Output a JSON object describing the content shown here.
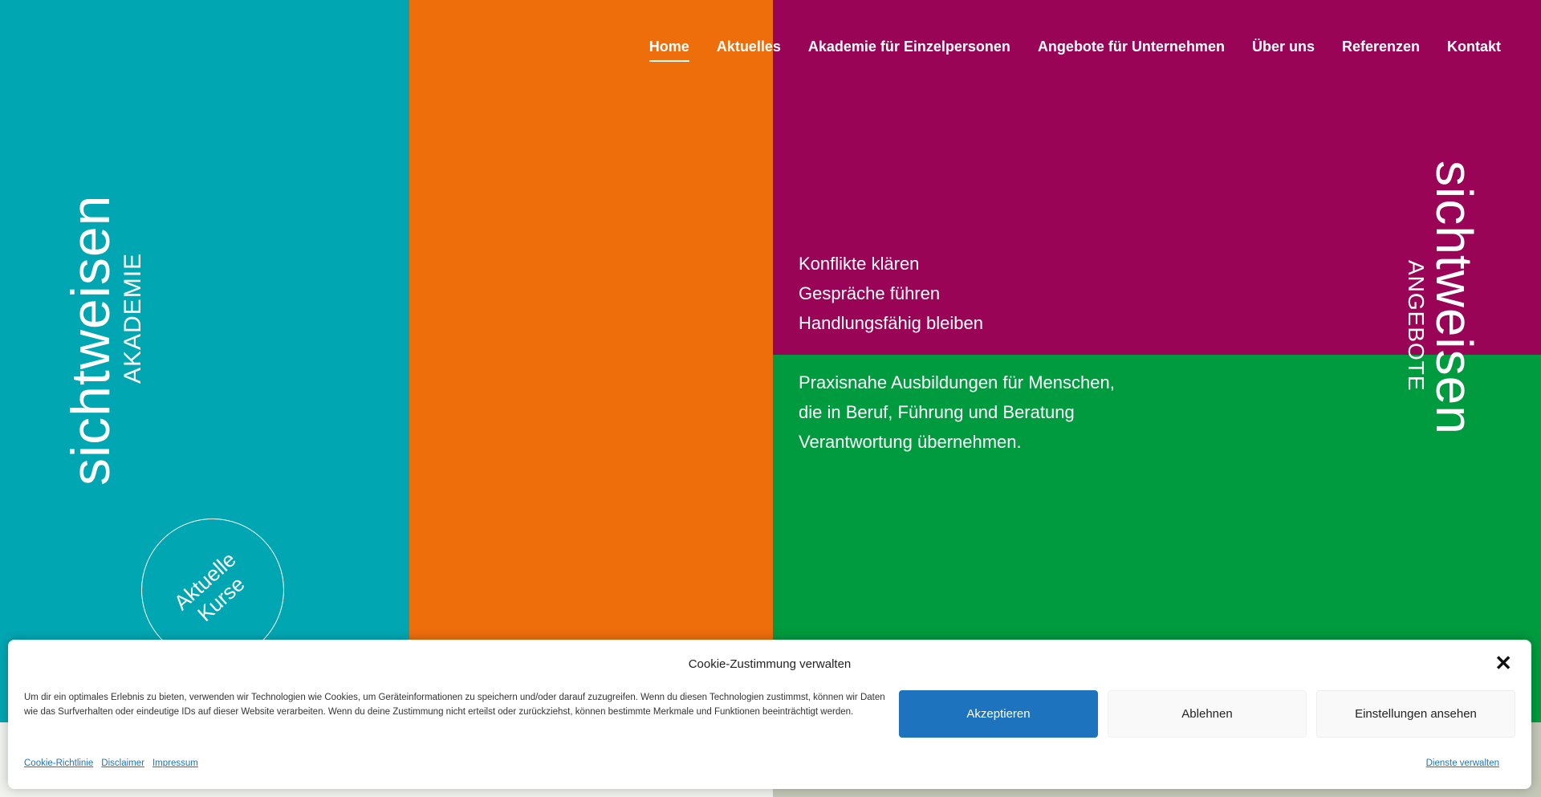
{
  "colors": {
    "teal": "#00a7b3",
    "orange": "#ee6e0b",
    "magenta": "#9a0456",
    "green": "#009b3e",
    "accept_button": "#1e73be"
  },
  "nav": {
    "items": [
      {
        "label": "Home",
        "active": true
      },
      {
        "label": "Aktuelles"
      },
      {
        "label": "Akademie für Einzelpersonen"
      },
      {
        "label": "Angebote für Unternehmen"
      },
      {
        "label": "Über uns"
      },
      {
        "label": "Referenzen"
      },
      {
        "label": "Kontakt"
      }
    ]
  },
  "logo_left": {
    "word": "sichtweisen",
    "sub": "AKADEMIE"
  },
  "logo_right": {
    "word": "sichtweisen",
    "sub": "ANGEBOTE"
  },
  "courses_button": {
    "line1": "Aktuelle",
    "line2": "Kurse"
  },
  "tagline": [
    "Konflikte klären",
    "Gespräche führen",
    "Handlungsfähig bleiben"
  ],
  "description": [
    "Praxisnahe Ausbildungen für Menschen,",
    "die in Beruf, Führung und Beratung",
    "Verantwortung übernehmen."
  ],
  "cookie": {
    "title": "Cookie-Zustimmung verwalten",
    "text": "Um dir ein optimales Erlebnis zu bieten, verwenden wir Technologien wie Cookies, um Geräteinformationen zu speichern und/oder darauf zuzugreifen. Wenn du diesen Technologien zustimmst, können wir Daten wie das Surfverhalten oder eindeutige IDs auf dieser Website verarbeiten. Wenn du deine Zustimmung nicht erteilst oder zurückziehst, können bestimmte Merkmale und Funktionen beeinträchtigt werden.",
    "accept": "Akzeptieren",
    "deny": "Ablehnen",
    "settings": "Einstellungen ansehen",
    "links": [
      "Cookie-Richtlinie",
      "Disclaimer",
      "Impressum"
    ],
    "manage": "Dienste verwalten",
    "close_icon": "close-icon"
  }
}
